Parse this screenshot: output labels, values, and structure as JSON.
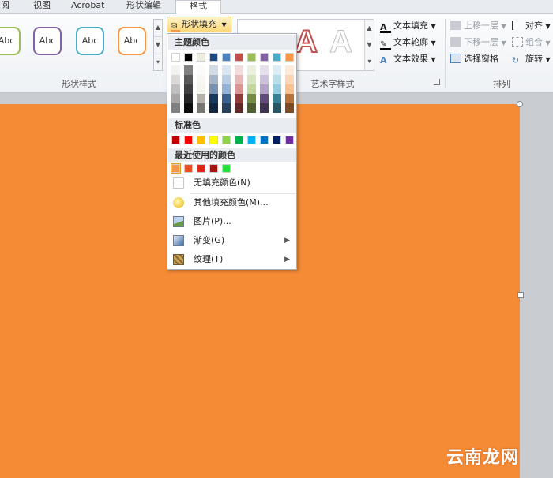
{
  "tabs": [
    {
      "label": "审阅"
    },
    {
      "label": "视图"
    },
    {
      "label": "Acrobat"
    },
    {
      "label": "形状编辑"
    },
    {
      "label": "格式"
    }
  ],
  "shape_styles": {
    "group_label": "形状样式",
    "gallery": [
      {
        "label": "Abc",
        "border": "#9bbb59"
      },
      {
        "label": "Abc",
        "border": "#8064a2"
      },
      {
        "label": "Abc",
        "border": "#4bacc6"
      },
      {
        "label": "Abc",
        "border": "#f79646"
      }
    ],
    "fill_button": "形状填充"
  },
  "wordart": {
    "group_label": "艺术字样式",
    "text_fill": "文本填充",
    "text_outline": "文本轮廓",
    "text_effects": "文本效果"
  },
  "arrange": {
    "group_label": "排列",
    "bring_forward": "上移一层",
    "send_backward": "下移一层",
    "selection_pane": "选择窗格",
    "align": "对齐",
    "group": "组合",
    "rotate": "旋转"
  },
  "dropdown": {
    "theme_colors_header": "主题颜色",
    "theme_colors": [
      "#ffffff",
      "#000000",
      "#eeece1",
      "#1f497d",
      "#4f81bd",
      "#c0504d",
      "#9bbb59",
      "#8064a2",
      "#4bacc6",
      "#f79646"
    ],
    "standard_header": "标准色",
    "standard_colors": [
      "#c00000",
      "#ff0000",
      "#ffc000",
      "#ffff00",
      "#92d050",
      "#00b050",
      "#00b0f0",
      "#0070c0",
      "#002060",
      "#7030a0"
    ],
    "recent_header": "最近使用的颜色",
    "recent_colors": [
      "#f79646",
      "#e84c22",
      "#e0251b",
      "#a31515",
      "#22e23a"
    ],
    "no_fill": "无填充颜色(N)",
    "more_colors": "其他填充颜色(M)...",
    "picture": "图片(P)...",
    "gradient": "渐变(G)",
    "texture": "纹理(T)"
  },
  "watermark": "云南龙网",
  "colors": {
    "slide_fill": "#f68b35",
    "ribbon_bg": "#eef1f5"
  }
}
